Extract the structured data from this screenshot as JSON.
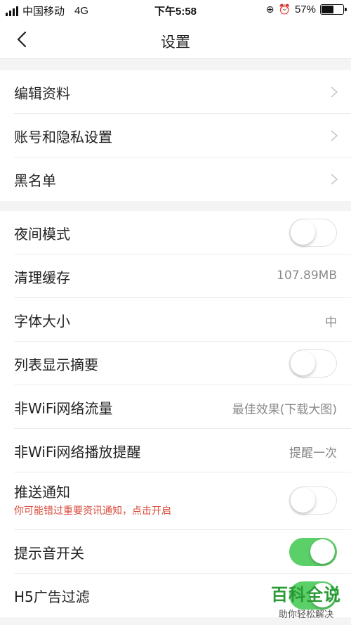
{
  "status_bar": {
    "carrier": "中国移动",
    "network": "4G",
    "time": "下午5:58",
    "battery": "57%",
    "battery_level": 0.57
  },
  "nav": {
    "title": "设置",
    "back_icon": "chevron-left-icon"
  },
  "section1": {
    "items": [
      {
        "label": "编辑资料"
      },
      {
        "label": "账号和隐私设置"
      },
      {
        "label": "黑名单"
      }
    ]
  },
  "section2": {
    "items": [
      {
        "label": "夜间模式",
        "toggle": false
      },
      {
        "label": "清理缓存",
        "value": "107.89MB"
      },
      {
        "label": "字体大小",
        "value": "中"
      },
      {
        "label": "列表显示摘要",
        "toggle": false
      },
      {
        "label": "非WiFi网络流量",
        "value": "最佳效果(下载大图)"
      },
      {
        "label": "非WiFi网络播放提醒",
        "value": "提醒一次"
      },
      {
        "label": "推送通知",
        "sublabel": "你可能错过重要资讯通知，点击开启",
        "toggle": false
      },
      {
        "label": "提示音开关",
        "toggle": true
      },
      {
        "label": "H5广告过滤",
        "toggle": true
      }
    ]
  },
  "watermark": {
    "title": "百科全说",
    "subtitle": "助你轻松解决"
  },
  "colors": {
    "toggle_on": "#5bd068",
    "warning_text": "#d94b3b",
    "watermark": "#2a9a36"
  }
}
